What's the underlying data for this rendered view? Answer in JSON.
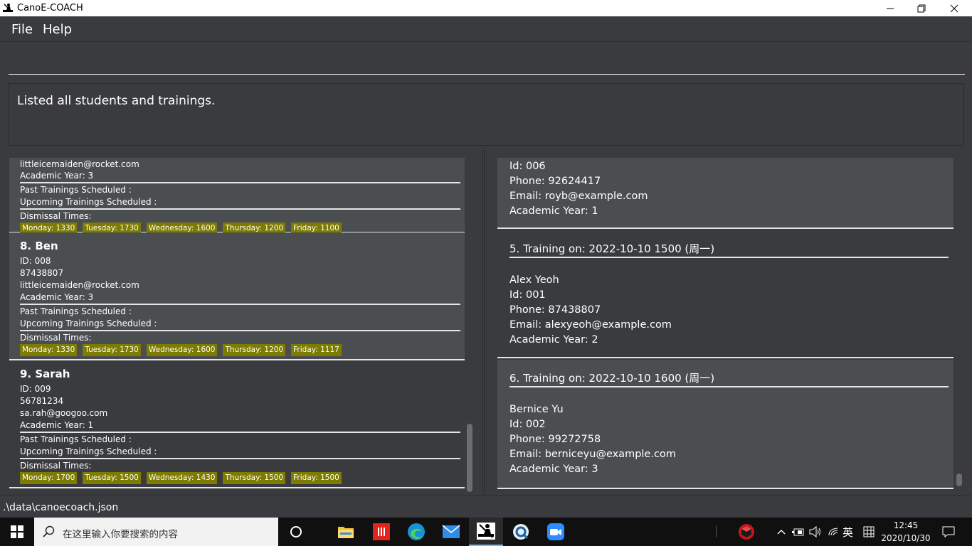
{
  "window": {
    "title": "CanoE-COACH",
    "controls": [
      "minimize-icon",
      "restore-icon",
      "close-icon"
    ]
  },
  "menu": {
    "file": "File",
    "help": "Help"
  },
  "command": {
    "value": "",
    "placeholder": ""
  },
  "result": {
    "message": "Listed all students and trainings."
  },
  "students": {
    "partial_top": {
      "email": "littleicemaiden@rocket.com",
      "year": "Academic Year: 3",
      "past": "Past Trainings Scheduled :",
      "upcoming": "Upcoming Trainings Scheduled :",
      "dismissal_label": "Dismissal Times:",
      "tags": [
        "Monday: 1330",
        "Tuesday: 1730",
        "Wednesday: 1600",
        "Thursday: 1200",
        "Friday: 1100"
      ]
    },
    "cards": [
      {
        "name": "8.  Ben",
        "id": "ID: 008",
        "phone": "87438807",
        "email": "littleicemaiden@rocket.com",
        "year": "Academic Year: 3",
        "past": "Past Trainings Scheduled :",
        "upcoming": "Upcoming Trainings Scheduled :",
        "dismissal_label": "Dismissal Times:",
        "tags": [
          "Monday: 1330",
          "Tuesday: 1730",
          "Wednesday: 1600",
          "Thursday: 1200",
          "Friday: 1117"
        ]
      },
      {
        "name": "9.  Sarah",
        "id": "ID: 009",
        "phone": "56781234",
        "email": "sa.rah@googoo.com",
        "year": "Academic Year: 1",
        "past": "Past Trainings Scheduled :",
        "upcoming": "Upcoming Trainings Scheduled :",
        "dismissal_label": "Dismissal Times:",
        "tags": [
          "Monday: 1700",
          "Tuesday: 1500",
          "Wednesday: 1430",
          "Thursday: 1500",
          "Friday: 1500"
        ]
      }
    ]
  },
  "trainings": {
    "partial_top": {
      "id": "Id: 006",
      "phone": "Phone: 92624417",
      "email": "Email: royb@example.com",
      "year": "Academic  Year: 1"
    },
    "cards": [
      {
        "title": "5.  Training on: 2022-10-10 1500 (周一)",
        "student_name": "Alex Yeoh",
        "id": "Id: 001",
        "phone": "Phone: 87438807",
        "email": "Email: alexyeoh@example.com",
        "year": "Academic  Year: 2"
      },
      {
        "title": "6.  Training on: 2022-10-10 1600 (周一)",
        "student_name": "Bernice Yu",
        "id": "Id: 002",
        "phone": "Phone: 99272758",
        "email": "Email: berniceyu@example.com",
        "year": "Academic  Year: 3"
      }
    ]
  },
  "status": {
    "path": ".\\data\\canoecoach.json"
  },
  "taskbar": {
    "search_placeholder": "在这里输入你要搜索的内容",
    "language": "英",
    "time": "12:45",
    "date": "2020/10/30",
    "icons": [
      "windows-start-icon",
      "search-icon",
      "cortana-icon",
      "file-explorer-icon",
      "app-red-icon",
      "edge-icon",
      "mail-icon",
      "canoe-coach-icon",
      "browser-icon",
      "zoom-icon",
      "antivirus-icon",
      "chevron-up-icon",
      "battery-icon",
      "volume-icon",
      "wifi-icon",
      "ime-icon",
      "notification-icon"
    ]
  },
  "colors": {
    "background": "#3a3b3e",
    "card_alt": "#4b4e51",
    "tag": "#7d7b00",
    "taskbar": "#101010"
  }
}
